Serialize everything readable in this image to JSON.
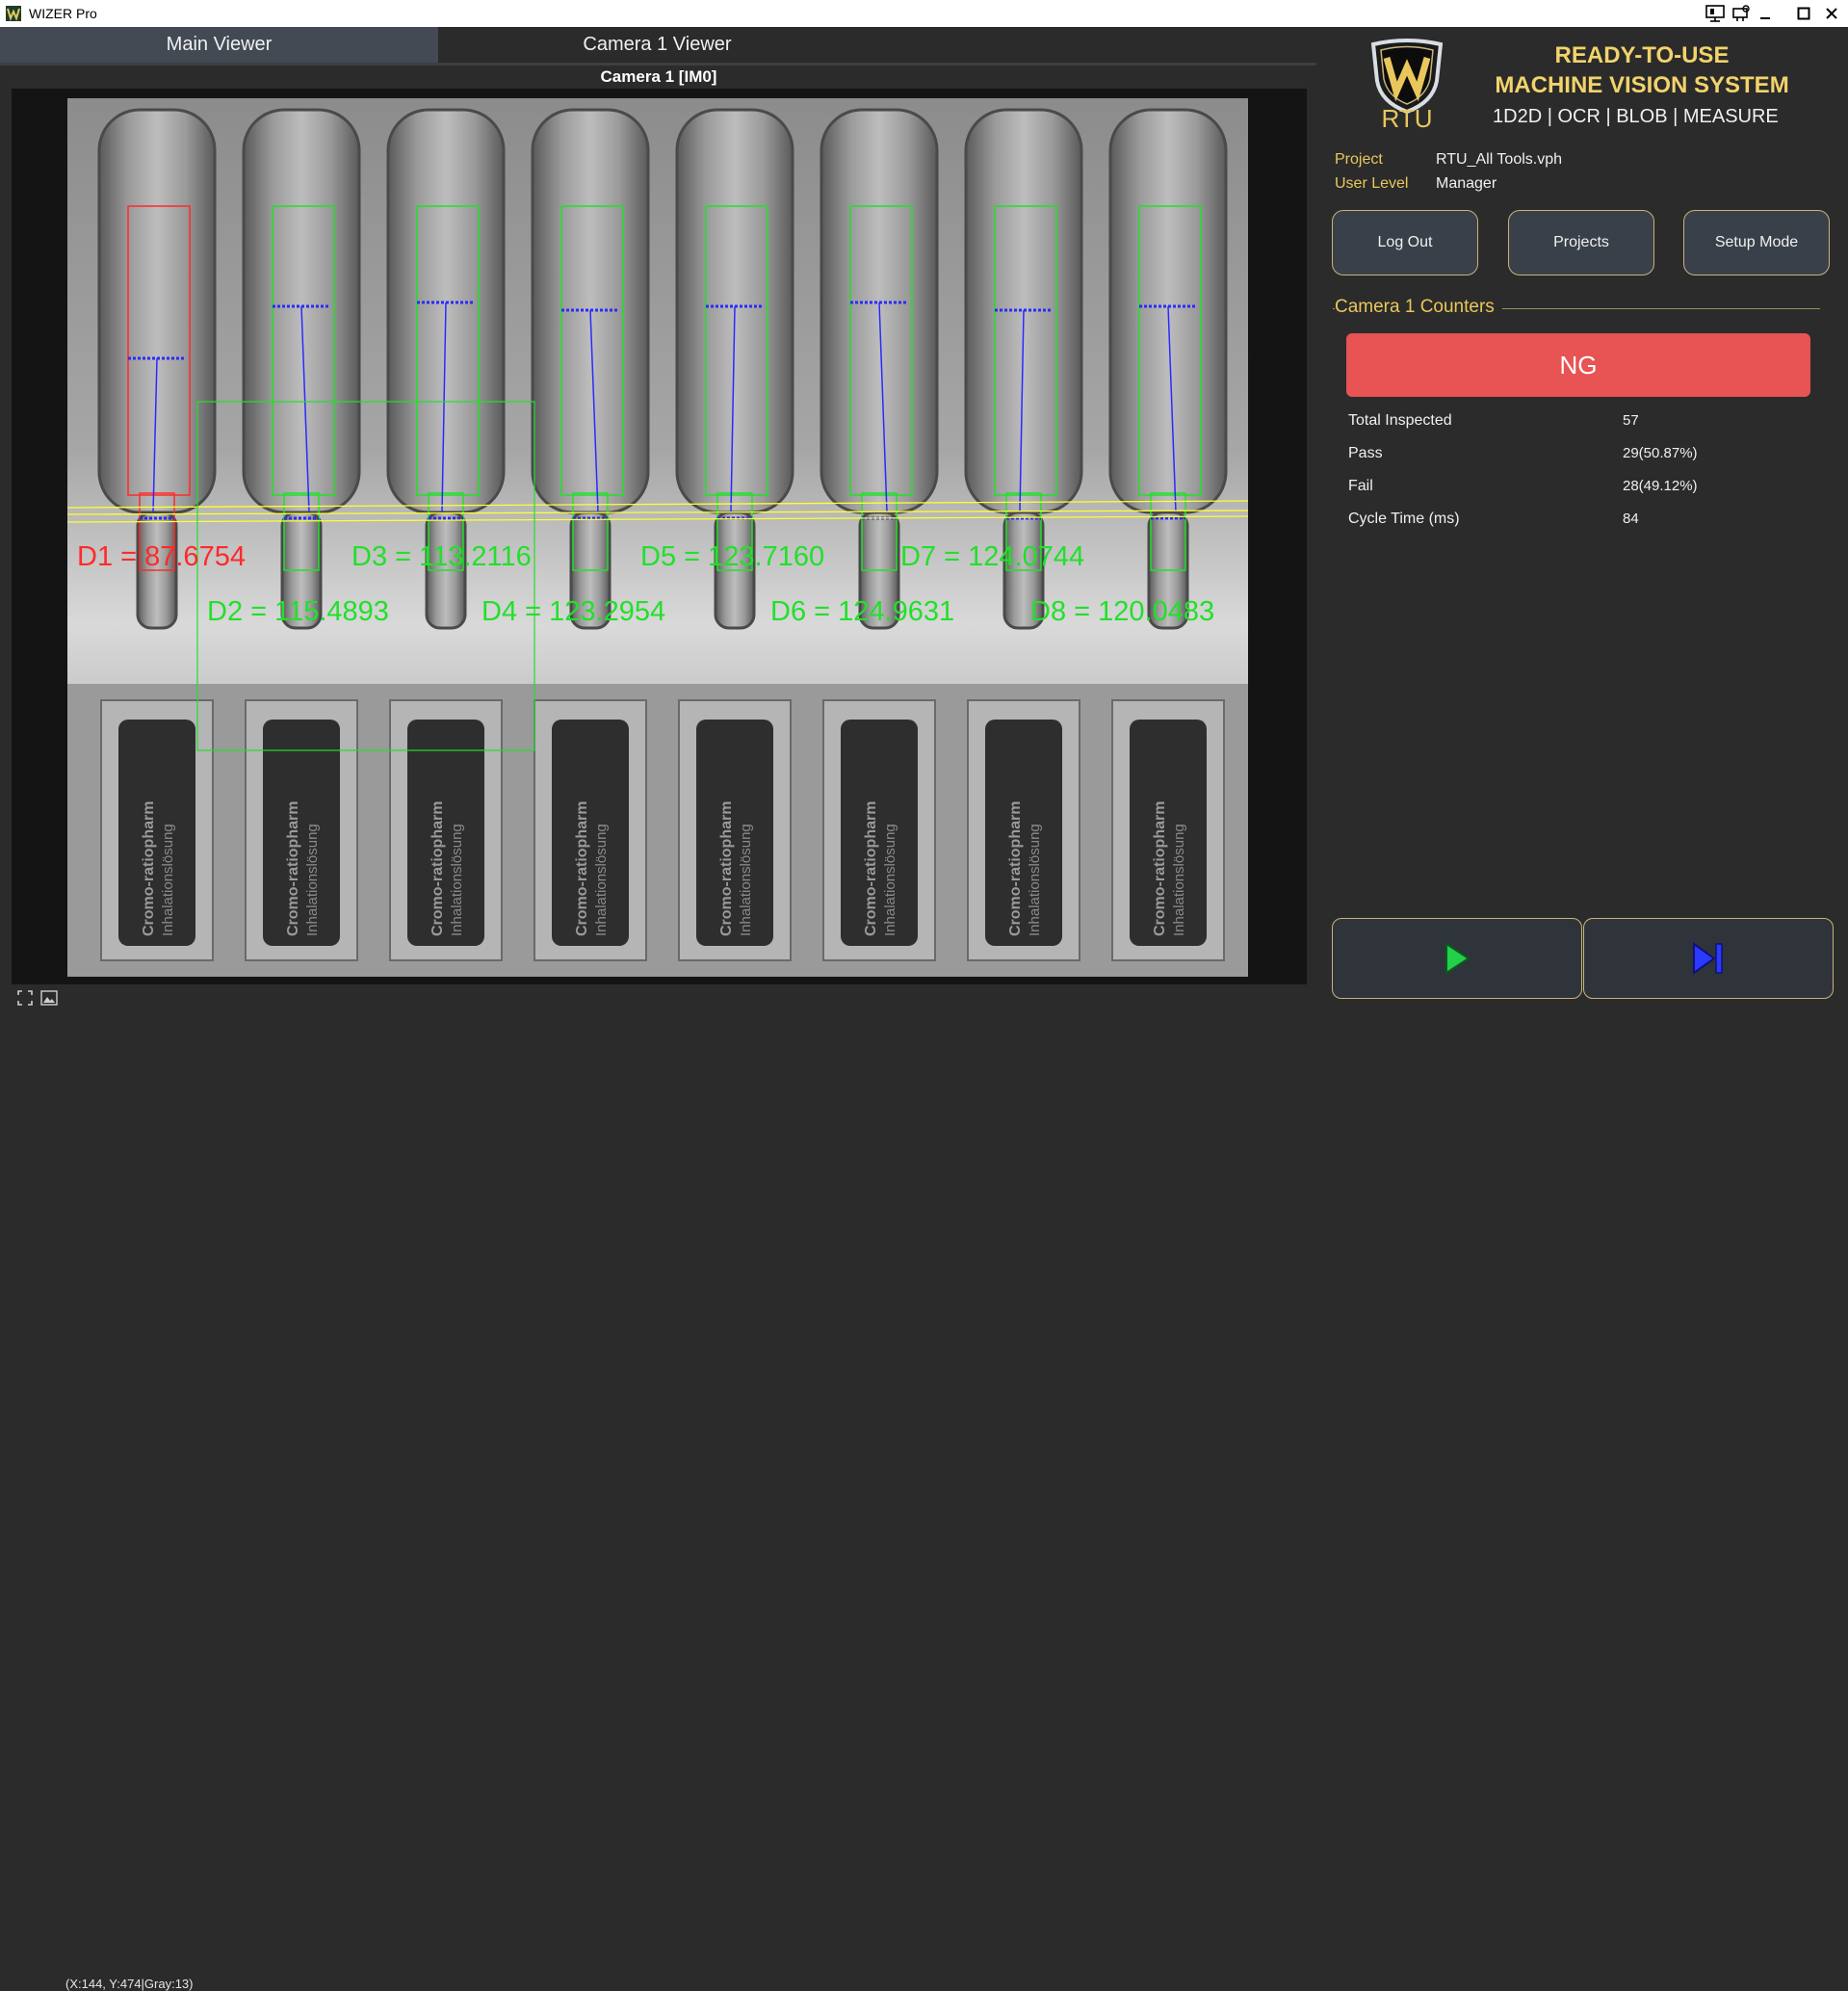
{
  "window": {
    "title": "WIZER Pro"
  },
  "tabs": [
    {
      "label": "Main Viewer",
      "active": true
    },
    {
      "label": "Camera 1 Viewer",
      "active": false
    }
  ],
  "viewer": {
    "caption": "Camera 1  [IM0]",
    "measurements": [
      {
        "label": "D1 = 87.6754",
        "status": "fail"
      },
      {
        "label": "D2 = 115.4893",
        "status": "pass"
      },
      {
        "label": "D3 = 113.2116",
        "status": "pass"
      },
      {
        "label": "D4 = 123.2954",
        "status": "pass"
      },
      {
        "label": "D5 = 123.7160",
        "status": "pass"
      },
      {
        "label": "D6 = 124.9631",
        "status": "pass"
      },
      {
        "label": "D7 = 124.0744",
        "status": "pass"
      },
      {
        "label": "D8 = 120.0483",
        "status": "pass"
      }
    ],
    "label_text": "Cromo-ratiopharm",
    "label_sub": "Inhalationslösung",
    "colors": {
      "fail": "#ff2a2a",
      "pass": "#22e02a",
      "points": "#2a2aff",
      "lines": "#ffff30"
    }
  },
  "brand": {
    "logo_text": "RTU",
    "line1": "READY-TO-USE",
    "line2": "MACHINE VISION SYSTEM",
    "tools": "1D2D | OCR | BLOB | MEASURE",
    "accent": "#f2d36b"
  },
  "info": {
    "project_label": "Project",
    "project_value": "RTU_All Tools.vph",
    "user_level_label": "User Level",
    "user_level_value": "Manager"
  },
  "buttons": {
    "logout": "Log Out",
    "projects": "Projects",
    "setup": "Setup Mode"
  },
  "counters": {
    "title": "Camera 1 Counters",
    "status": "NG",
    "status_color": "#e85353",
    "rows": [
      {
        "label": "Total Inspected",
        "value": "57"
      },
      {
        "label": "Pass",
        "value": "29(50.87%)"
      },
      {
        "label": "Fail",
        "value": "28(49.12%)"
      },
      {
        "label": "Cycle Time (ms)",
        "value": "84"
      }
    ]
  },
  "controls": {
    "run_icon": "play-icon",
    "step_icon": "step-forward-icon"
  },
  "statusbar": {
    "coords": "(X:144, Y:474|Gray:13)"
  }
}
